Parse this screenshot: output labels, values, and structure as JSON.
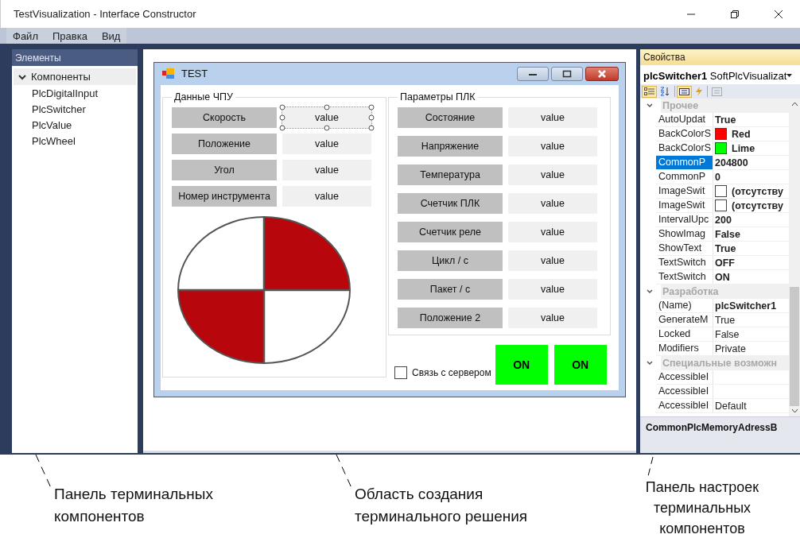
{
  "window": {
    "title": "TestVisualization - Interface Constructor"
  },
  "menu": [
    "Файл",
    "Правка",
    "Вид"
  ],
  "elements_panel": {
    "title": "Элементы",
    "tree": [
      {
        "label": "Компоненты",
        "expanded": true,
        "selected": true,
        "children": [
          {
            "label": "PlcDigitalInput",
            "selected": false
          },
          {
            "label": "PlcSwitcher",
            "selected": false
          },
          {
            "label": "PlcValue",
            "selected": false
          },
          {
            "label": "PlcWheel",
            "selected": false
          }
        ]
      }
    ]
  },
  "form": {
    "title": "TEST",
    "groups": [
      {
        "title": "Данные ЧПУ",
        "wheel": true,
        "rows": [
          {
            "label": "Скорость",
            "value": "value",
            "selected": true
          },
          {
            "label": "Положение",
            "value": "value",
            "selected": false
          },
          {
            "label": "Угол",
            "value": "value",
            "selected": false
          },
          {
            "label": "Номер инструмента",
            "value": "value",
            "selected": false
          }
        ]
      },
      {
        "title": "Параметры ПЛК",
        "wheel": false,
        "rows": [
          {
            "label": "Состояние",
            "value": "value",
            "selected": false
          },
          {
            "label": "Напряжение",
            "value": "value",
            "selected": false
          },
          {
            "label": "Температура",
            "value": "value",
            "selected": false
          },
          {
            "label": "Счетчик ПЛК",
            "value": "value",
            "selected": false
          },
          {
            "label": "Счетчик реле",
            "value": "value",
            "selected": false
          },
          {
            "label": "Цикл / с",
            "value": "value",
            "selected": false
          },
          {
            "label": "Пакет / с",
            "value": "value",
            "selected": false
          },
          {
            "label": "Положение 2",
            "value": "value",
            "selected": false
          }
        ]
      }
    ],
    "checkbox": {
      "label": "Связь с сервером",
      "checked": false
    },
    "switches": [
      {
        "label": "ON",
        "color": "#00ff00"
      },
      {
        "label": "ON",
        "color": "#00ff00"
      }
    ]
  },
  "properties": {
    "title": "Свойства",
    "object_name": "plcSwitcher1",
    "object_type": "SoftPlcVisualizat",
    "toolbar": [
      {
        "kind": "categorized",
        "selected": true
      },
      {
        "kind": "alphabetical",
        "selected": false
      },
      {
        "kind": "properties",
        "selected": true
      },
      {
        "kind": "events",
        "selected": false
      },
      {
        "kind": "pages",
        "selected": false
      }
    ],
    "categories": [
      {
        "title": "Прочее",
        "expanded": true,
        "rows": [
          {
            "name": "AutoUpdat",
            "value": "True",
            "bold": true,
            "selected": false
          },
          {
            "name": "BackColorS",
            "value": "Red",
            "bold": true,
            "color": "#ff0000",
            "selected": false
          },
          {
            "name": "BackColorS",
            "value": "Lime",
            "bold": true,
            "color": "#00ff00",
            "selected": false
          },
          {
            "name": "CommonP",
            "value": "204800",
            "bold": true,
            "selected": true
          },
          {
            "name": "CommonP",
            "value": "0",
            "bold": true,
            "selected": false
          },
          {
            "name": "ImageSwit",
            "value": "(отсутству",
            "bold": true,
            "color": "#ffffff",
            "selected": false
          },
          {
            "name": "ImageSwit",
            "value": "(отсутству",
            "bold": true,
            "color": "#ffffff",
            "selected": false
          },
          {
            "name": "IntervalUpc",
            "value": "200",
            "bold": true,
            "selected": false
          },
          {
            "name": "ShowImag",
            "value": "False",
            "bold": true,
            "selected": false
          },
          {
            "name": "ShowText",
            "value": "True",
            "bold": true,
            "selected": false
          },
          {
            "name": "TextSwitch",
            "value": "OFF",
            "bold": true,
            "selected": false
          },
          {
            "name": "TextSwitch",
            "value": "ON",
            "bold": true,
            "selected": false
          }
        ]
      },
      {
        "title": "Разработка",
        "expanded": true,
        "rows": [
          {
            "name": "(Name)",
            "value": "plcSwitcher1",
            "bold": true,
            "selected": false
          },
          {
            "name": "GenerateM",
            "value": "True",
            "bold": false,
            "selected": false
          },
          {
            "name": "Locked",
            "value": "False",
            "bold": false,
            "selected": false
          },
          {
            "name": "Modifiers",
            "value": "Private",
            "bold": false,
            "selected": false
          }
        ]
      },
      {
        "title": "Специальные возможн",
        "expanded": true,
        "rows": [
          {
            "name": "AccessibleI",
            "bold": false,
            "selected": false
          },
          {
            "name": "AccessibleI",
            "bold": false,
            "selected": false
          },
          {
            "name": "AccessibleI",
            "value": "Default",
            "bold": false,
            "selected": false
          }
        ]
      }
    ],
    "description": "CommonPlcMemoryAdressB"
  },
  "annotations": [
    {
      "lines": [
        "Панель терминальных",
        "компонентов"
      ]
    },
    {
      "lines": [
        "Область создания",
        "терминального решения"
      ]
    },
    {
      "lines": [
        "Панель настроек",
        "терминальных",
        "компонентов"
      ]
    }
  ]
}
